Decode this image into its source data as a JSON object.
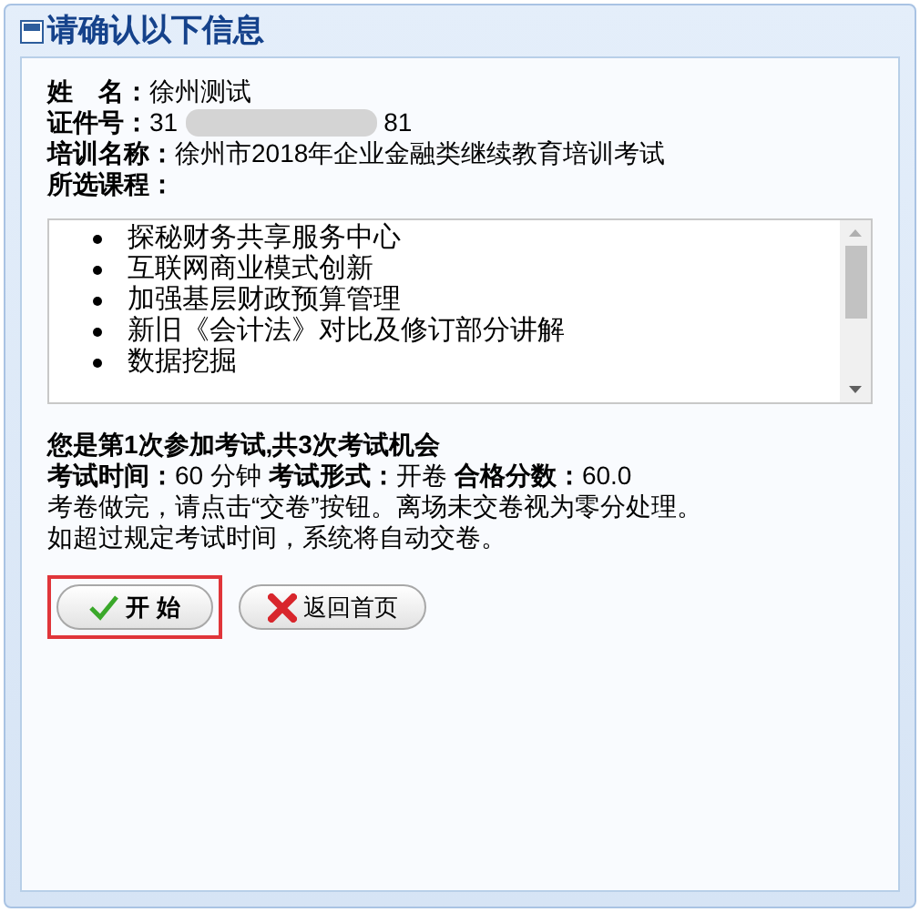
{
  "window": {
    "title": "请确认以下信息"
  },
  "info": [
    {
      "label": "姓　名：",
      "value": "徐州测试",
      "kind": "text"
    },
    {
      "label": "证件号：",
      "value_prefix": "31",
      "value_suffix": "81",
      "kind": "redacted"
    },
    {
      "label": "培训名称：",
      "value": "徐州市2018年企业金融类继续教育培训考试",
      "kind": "text"
    },
    {
      "label": "所选课程：",
      "kind": "heading"
    }
  ],
  "courses": [
    "探秘财务共享服务中心",
    "互联网商业模式创新",
    "加强基层财政预算管理",
    "新旧《会计法》对比及修订部分讲解",
    "数据挖掘"
  ],
  "attempt_notice": "您是第1次参加考试,共3次考试机会",
  "exam_details": [
    {
      "label": "考试时间：",
      "value": "60 分钟"
    },
    {
      "label": "考试形式：",
      "value": "开卷"
    },
    {
      "label": "合格分数：",
      "value": "60.0"
    }
  ],
  "instructions": [
    "考卷做完，请点击“交卷”按钮。离场未交卷视为零分处理。",
    "如超过规定考试时间，系统将自动交卷。"
  ],
  "buttons": [
    {
      "label": "开 始",
      "kind": "start",
      "highlighted": true
    },
    {
      "label": "返回首页",
      "kind": "home",
      "highlighted": false
    }
  ]
}
